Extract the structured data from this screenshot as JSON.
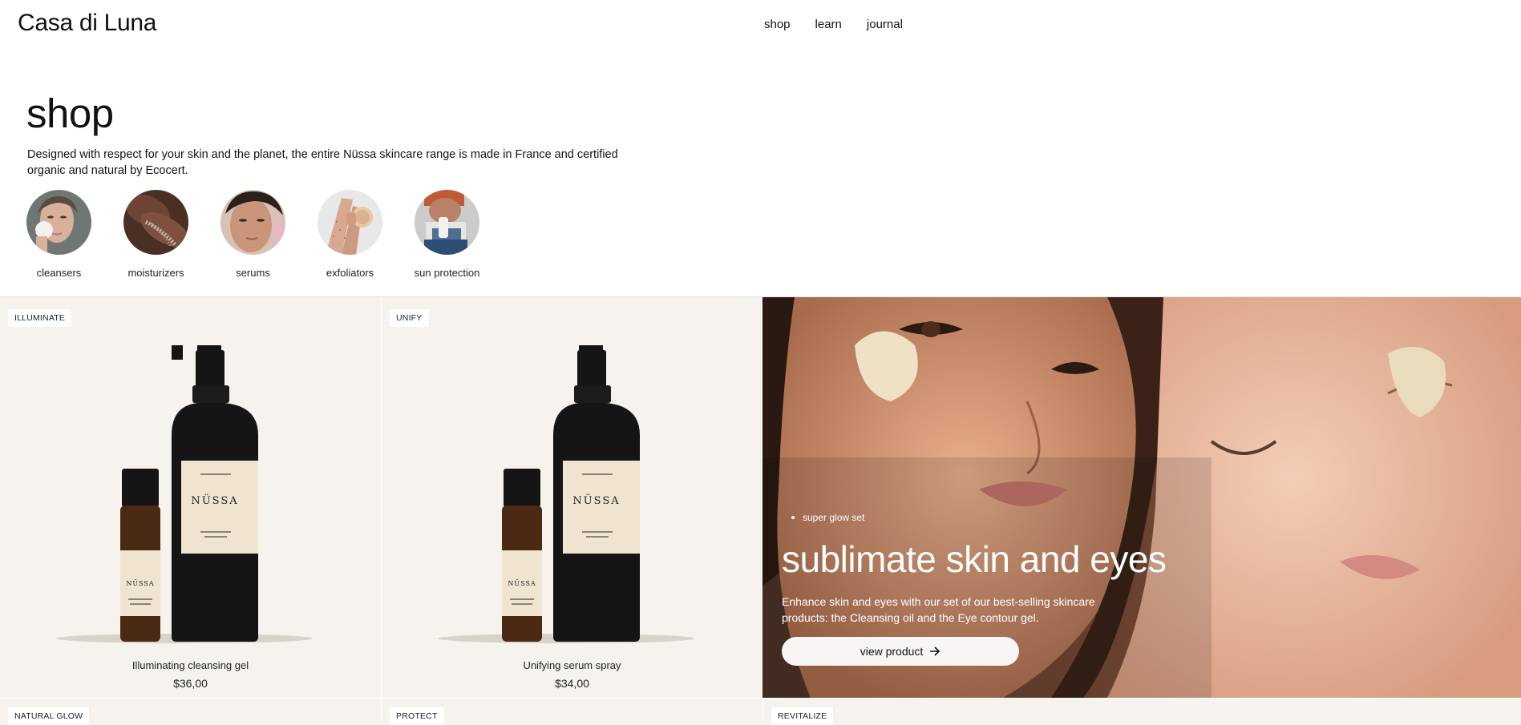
{
  "brand": {
    "name": "Casa di Luna"
  },
  "nav": {
    "shop": "shop",
    "learn": "learn",
    "journal": "journal"
  },
  "page": {
    "title": "shop",
    "intro": "Designed with respect for your skin and the planet, the entire Nüssa skincare range is made in France and certified organic and natural by Ecocert."
  },
  "categories": [
    {
      "label": "cleansers"
    },
    {
      "label": "moisturizers"
    },
    {
      "label": "serums"
    },
    {
      "label": "exfoliators"
    },
    {
      "label": "sun protection"
    }
  ],
  "products": [
    {
      "badge": "ILLUMINATE",
      "name": "Illuminating cleansing gel",
      "price": "$36,00"
    },
    {
      "badge": "UNIFY",
      "name": "Unifying serum spray",
      "price": "$34,00"
    }
  ],
  "hero": {
    "bullet": "super glow set",
    "title": "sublimate skin and eyes",
    "description": "Enhance skin and eyes with our set of our best-selling skincare products: the Cleansing oil and the Eye contour gel.",
    "button": "view product"
  },
  "next_row_badges": [
    "NATURAL GLOW",
    "PROTECT",
    "REVITALIZE"
  ],
  "bottle_label": {
    "brand": "NÜSSA"
  },
  "colors": {
    "card_bg": "#f6f2ee",
    "bottle": "#151515",
    "label": "#efe4d0",
    "vial": "#5a3418"
  }
}
